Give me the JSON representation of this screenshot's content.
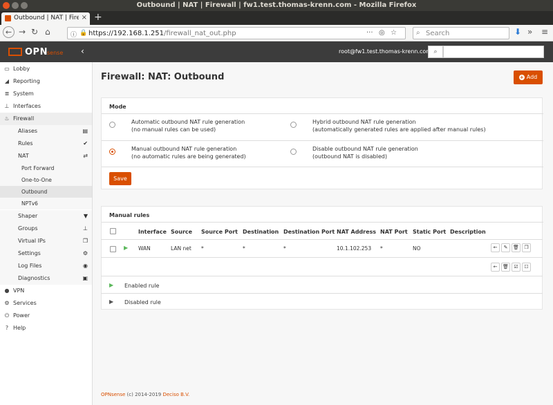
{
  "window": {
    "title": "Outbound | NAT | Firewall | fw1.test.thomas-krenn.com - Mozilla Firefox"
  },
  "browser": {
    "tab_title": "Outbound | NAT | Firewall",
    "new_tab_label": "+",
    "url_host": "https://192.168.1.251",
    "url_path": "/firewall_nat_out.php",
    "search_placeholder": "Search"
  },
  "header": {
    "logo_text": "OPN",
    "logo_sub": "sense",
    "user": "root@fw1.test.thomas-krenn.com"
  },
  "sidebar": {
    "items": [
      {
        "label": "Lobby",
        "icon": "laptop-icon"
      },
      {
        "label": "Reporting",
        "icon": "area-chart-icon"
      },
      {
        "label": "System",
        "icon": "server-icon"
      },
      {
        "label": "Interfaces",
        "icon": "sitemap-icon"
      },
      {
        "label": "Firewall",
        "icon": "fire-icon"
      },
      {
        "label": "Aliases",
        "icon": "list-icon"
      },
      {
        "label": "Rules",
        "icon": "check-icon"
      },
      {
        "label": "NAT",
        "icon": "exchange-icon"
      },
      {
        "label": "Port Forward"
      },
      {
        "label": "One-to-One"
      },
      {
        "label": "Outbound"
      },
      {
        "label": "NPTv6"
      },
      {
        "label": "Shaper",
        "icon": "filter-icon"
      },
      {
        "label": "Groups",
        "icon": "sitemap-icon"
      },
      {
        "label": "Virtual IPs",
        "icon": "clone-icon"
      },
      {
        "label": "Settings",
        "icon": "cogs-icon"
      },
      {
        "label": "Log Files",
        "icon": "eye-icon"
      },
      {
        "label": "Diagnostics",
        "icon": "medkit-icon"
      },
      {
        "label": "VPN",
        "icon": "globe-icon"
      },
      {
        "label": "Services",
        "icon": "cog-icon"
      },
      {
        "label": "Power",
        "icon": "plug-icon"
      },
      {
        "label": "Help",
        "icon": "help-icon"
      }
    ]
  },
  "main": {
    "title": "Firewall: NAT: Outbound",
    "add_label": "Add",
    "mode": {
      "heading": "Mode",
      "options": [
        {
          "line1": "Automatic outbound NAT rule generation",
          "line2": "(no manual rules can be used)",
          "selected": false
        },
        {
          "line1": "Hybrid outbound NAT rule generation",
          "line2": "(automatically generated rules are applied after manual rules)",
          "selected": false
        },
        {
          "line1": "Manual outbound NAT rule generation",
          "line2": "(no automatic rules are being generated)",
          "selected": true
        },
        {
          "line1": "Disable outbound NAT rule generation",
          "line2": "(outbound NAT is disabled)",
          "selected": false
        }
      ],
      "save_label": "Save"
    },
    "manual_rules": {
      "heading": "Manual rules",
      "columns": [
        "Interface",
        "Source",
        "Source Port",
        "Destination",
        "Destination Port",
        "NAT Address",
        "NAT Port",
        "Static Port",
        "Description"
      ],
      "rows": [
        {
          "interface": "WAN",
          "source": "LAN net",
          "source_port": "*",
          "destination": "*",
          "destination_port": "*",
          "nat_address": "10.1.102.253",
          "nat_port": "*",
          "static_port": "NO",
          "description": ""
        }
      ],
      "legend_enabled": "Enabled rule",
      "legend_disabled": "Disabled rule"
    }
  },
  "footer": {
    "brand": "OPNsense",
    "copyright": " (c) 2014-2019 ",
    "company": "Deciso B.V."
  },
  "colors": {
    "accent": "#d94f00",
    "header_bg": "#3c3c3c",
    "enabled": "#5cb85c"
  }
}
